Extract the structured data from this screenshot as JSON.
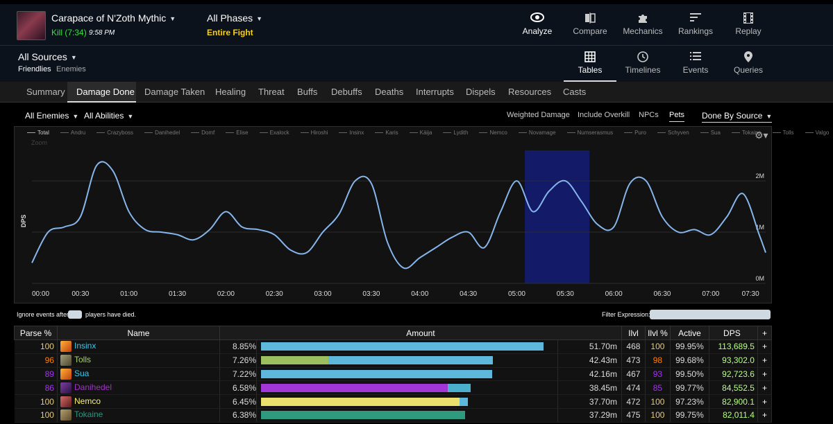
{
  "header": {
    "encounter": "Carapace of N'Zoth Mythic",
    "result": "Kill (7:34)",
    "time": "9:58 PM",
    "phase": "All Phases",
    "phase_sub": "Entire Fight",
    "nav": [
      {
        "label": "Analyze",
        "icon": "eye-icon",
        "active": true
      },
      {
        "label": "Compare",
        "icon": "compare-icon"
      },
      {
        "label": "Mechanics",
        "icon": "puzzle-icon"
      },
      {
        "label": "Rankings",
        "icon": "rankings-icon"
      },
      {
        "label": "Replay",
        "icon": "film-icon"
      }
    ]
  },
  "subheader": {
    "sources": "All Sources",
    "friendlies": "Friendlies",
    "enemies": "Enemies",
    "views": [
      {
        "label": "Tables",
        "icon": "grid-icon",
        "active": true
      },
      {
        "label": "Timelines",
        "icon": "clock-icon"
      },
      {
        "label": "Events",
        "icon": "list-icon"
      },
      {
        "label": "Queries",
        "icon": "pin-icon"
      }
    ]
  },
  "tabs": [
    "Summary",
    "Damage Done",
    "Damage Taken",
    "Healing",
    "Threat",
    "Buffs",
    "Debuffs",
    "Deaths",
    "Interrupts",
    "Dispels",
    "Resources",
    "Casts"
  ],
  "active_tab": "Damage Done",
  "filters": {
    "enemies": "All Enemies",
    "abilities": "All Abilities",
    "options": [
      "Weighted Damage",
      "Include Overkill",
      "NPCs",
      "Pets"
    ],
    "active_option": "Pets",
    "done_by": "Done By Source"
  },
  "chart_data": {
    "type": "line",
    "ylabel": "DPS",
    "zoom_label": "Zoom",
    "legend": [
      "Total",
      "Andru",
      "Crazyboss",
      "Danihedel",
      "Domf",
      "Elise",
      "Exalock",
      "Hiroshi",
      "Insinx",
      "Karis",
      "Käija",
      "Lydith",
      "Nemco",
      "Novamage",
      "Numserasmus",
      "Puro",
      "Schyven",
      "Sua",
      "Tokaine",
      "Tolls",
      "Valgo"
    ],
    "x_ticks": [
      "00:00",
      "00:30",
      "01:00",
      "01:30",
      "02:00",
      "02:30",
      "03:00",
      "03:30",
      "04:00",
      "04:30",
      "05:00",
      "05:30",
      "06:00",
      "06:30",
      "07:00",
      "07:30"
    ],
    "y_ticks": [
      "2M",
      "1M",
      "0M"
    ],
    "ylim": [
      0,
      2650000
    ],
    "xlim": [
      0,
      454
    ],
    "x": [
      0,
      10,
      20,
      30,
      40,
      50,
      60,
      70,
      80,
      90,
      100,
      110,
      120,
      130,
      140,
      150,
      160,
      170,
      180,
      190,
      200,
      210,
      220,
      230,
      240,
      250,
      260,
      270,
      280,
      290,
      300,
      310,
      320,
      330,
      340,
      350,
      360,
      370,
      380,
      390,
      400,
      410,
      420,
      430,
      440,
      450,
      454
    ],
    "values": [
      400000,
      1000000,
      1100000,
      1300000,
      2300000,
      2200000,
      1400000,
      1050000,
      1000000,
      950000,
      850000,
      1050000,
      1400000,
      1100000,
      1050000,
      950000,
      650000,
      600000,
      1000000,
      1350000,
      2000000,
      1950000,
      800000,
      300000,
      500000,
      700000,
      900000,
      1000000,
      700000,
      1400000,
      2000000,
      1400000,
      1800000,
      2000000,
      1600000,
      1150000,
      1100000,
      1950000,
      2000000,
      1300000,
      1000000,
      1050000,
      950000,
      1300000,
      1750000,
      950000,
      600000
    ],
    "highlight": [
      305,
      345
    ],
    "grid": true
  },
  "options_row": {
    "ignore_prefix": "Ignore events after",
    "ignore_suffix": "players have died.",
    "filter_label": "Filter Expression:"
  },
  "table": {
    "headers": [
      "Parse %",
      "Name",
      "Amount",
      "Ilvl",
      "Ilvl %",
      "Active",
      "DPS",
      "+"
    ],
    "rows": [
      {
        "parse": "100",
        "parse_color": "#e5cc80",
        "name": "Insinx",
        "name_color": "#3fc7eb",
        "icon": "fire-icon",
        "pct": "8.85%",
        "bar": [
          {
            "frac": 0.97,
            "color": "#5db8dc"
          }
        ],
        "amount": "51.70m",
        "ilvl": "468",
        "ilvlp": "100",
        "ilvlp_color": "#e5cc80",
        "active": "99.95%",
        "dps": "113,689.5"
      },
      {
        "parse": "96",
        "parse_color": "#ff8000",
        "name": "Tolls",
        "name_color": "#aad372",
        "icon": "hunter-icon",
        "pct": "7.26%",
        "bar": [
          {
            "frac": 0.23,
            "color": "#9cbf5f"
          },
          {
            "frac": 0.565,
            "color": "#5db8dc"
          }
        ],
        "amount": "42.43m",
        "ilvl": "473",
        "ilvlp": "98",
        "ilvlp_color": "#ff8000",
        "active": "99.68%",
        "dps": "93,302.0"
      },
      {
        "parse": "89",
        "parse_color": "#a335ee",
        "name": "Sua",
        "name_color": "#3fc7eb",
        "icon": "fire-icon",
        "pct": "7.22%",
        "bar": [
          {
            "frac": 0.792,
            "color": "#5db8dc"
          }
        ],
        "amount": "42.16m",
        "ilvl": "467",
        "ilvlp": "93",
        "ilvlp_color": "#a335ee",
        "active": "99.50%",
        "dps": "92,723.6"
      },
      {
        "parse": "86",
        "parse_color": "#a335ee",
        "name": "Danihedel",
        "name_color": "#a330c9",
        "icon": "demon-icon",
        "pct": "6.58%",
        "bar": [
          {
            "frac": 0.64,
            "color": "#a336d6"
          },
          {
            "frac": 0.08,
            "color": "#4ab0cc"
          }
        ],
        "amount": "38.45m",
        "ilvl": "474",
        "ilvlp": "85",
        "ilvlp_color": "#a335ee",
        "active": "99.77%",
        "dps": "84,552.5"
      },
      {
        "parse": "100",
        "parse_color": "#e5cc80",
        "name": "Nemco",
        "name_color": "#fff468",
        "icon": "rogue-icon",
        "pct": "6.45%",
        "bar": [
          {
            "frac": 0.68,
            "color": "#ebe06e"
          },
          {
            "frac": 0.03,
            "color": "#5db8dc"
          }
        ],
        "amount": "37.70m",
        "ilvl": "472",
        "ilvlp": "100",
        "ilvlp_color": "#e5cc80",
        "active": "97.23%",
        "dps": "82,900.1"
      },
      {
        "parse": "100",
        "parse_color": "#e5cc80",
        "name": "Tokaine",
        "name_color": "#33937f",
        "icon": "evoker-icon",
        "pct": "6.38%",
        "bar": [
          {
            "frac": 0.7,
            "color": "#2f9a7e"
          }
        ],
        "amount": "37.29m",
        "ilvl": "475",
        "ilvlp": "100",
        "ilvlp_color": "#e5cc80",
        "active": "99.75%",
        "dps": "82,011.4"
      }
    ]
  }
}
